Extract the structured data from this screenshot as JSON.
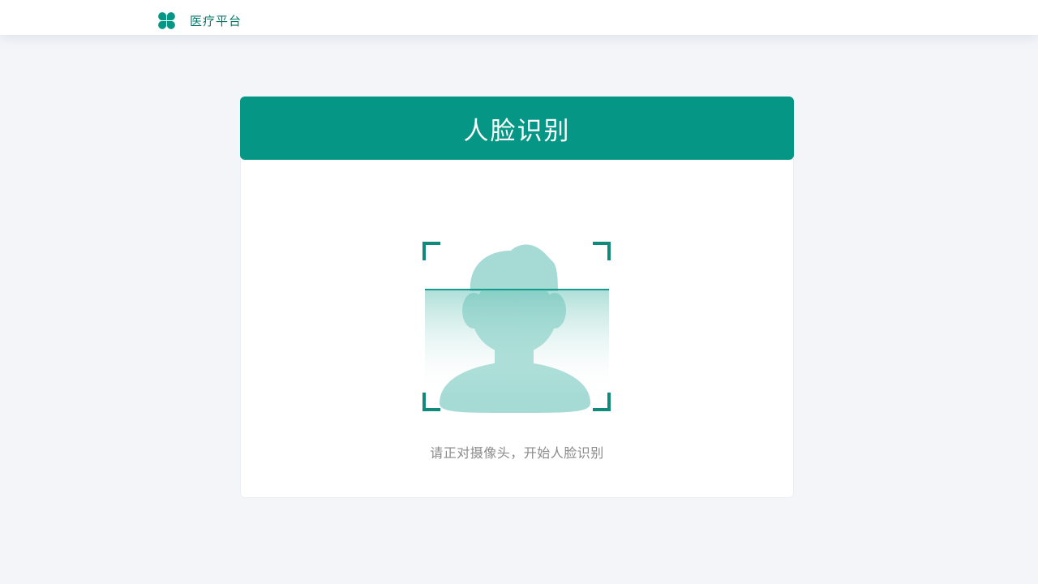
{
  "header": {
    "brand_name": "医疗平台",
    "logo_icon": "clover-logo-icon",
    "accent_color": "#069686"
  },
  "card": {
    "title": "人脸识别",
    "hint": "请正对摄像头，开始人脸识别",
    "scan_icon": "face-scan-icon"
  }
}
